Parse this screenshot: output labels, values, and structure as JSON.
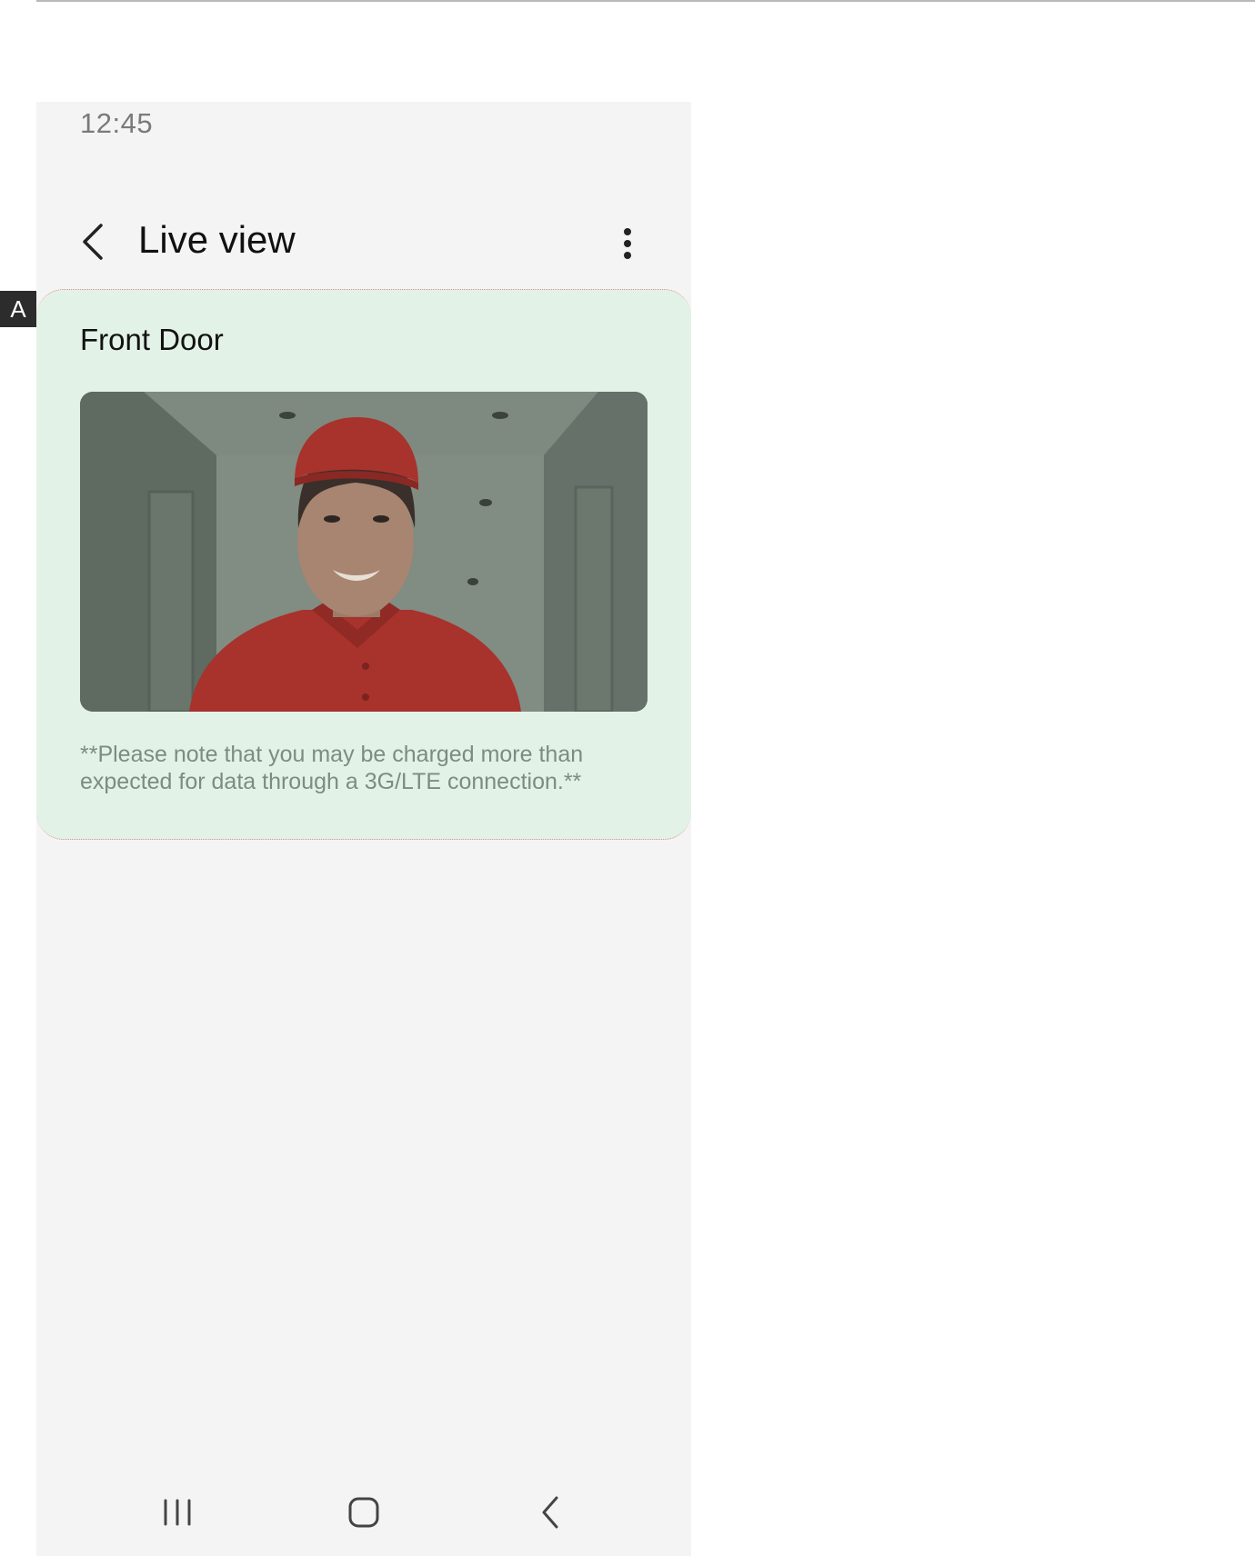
{
  "status_bar": {
    "time": "12:45"
  },
  "app_bar": {
    "title": "Live view",
    "back_icon": "chevron-left-icon",
    "menu_icon": "more-vert-icon"
  },
  "card": {
    "title": "Front Door",
    "feed_description": "camera-feed-image",
    "notice": "**Please note that you may be charged more than expected for data through a 3G/LTE connection.**"
  },
  "nav_bar": {
    "recents_icon": "recents-icon",
    "home_icon": "home-icon",
    "back_icon": "back-icon"
  },
  "overlay_label": "A",
  "colors": {
    "screen_bg": "#f4f4f4",
    "card_bg": "#e3f2e7",
    "notice_text": "#7d8c82",
    "title_text": "#111111",
    "status_text": "#7a7a7a"
  }
}
